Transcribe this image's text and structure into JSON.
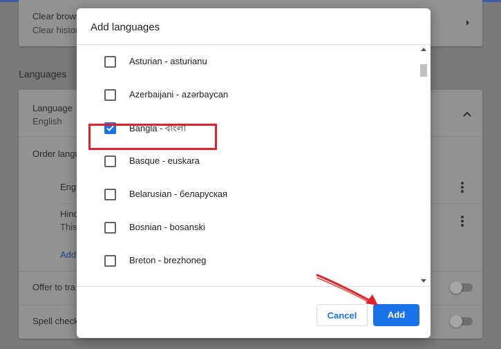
{
  "background": {
    "card1": {
      "title": "Clear brows",
      "subtitle": "Clear histor"
    },
    "section_title": "Languages",
    "language": {
      "label": "Language",
      "value": "English"
    },
    "order_label": "Order langu",
    "order_items": [
      {
        "label": "Engl",
        "sub": ""
      },
      {
        "label": "Hind",
        "sub": "This"
      }
    ],
    "add_link": "Add",
    "offer_translate": "Offer to tra",
    "spell_check": "Spell check"
  },
  "dialog": {
    "title": "Add languages",
    "languages": [
      {
        "label": "Asturian - asturianu",
        "checked": false
      },
      {
        "label": "Azerbaijani - azərbaycan",
        "checked": false
      },
      {
        "label": "Bangla - বাংলা",
        "checked": true
      },
      {
        "label": "Basque - euskara",
        "checked": false
      },
      {
        "label": "Belarusian - беларуская",
        "checked": false
      },
      {
        "label": "Bosnian - bosanski",
        "checked": false
      },
      {
        "label": "Breton - brezhoneg",
        "checked": false
      }
    ],
    "cancel_label": "Cancel",
    "add_label": "Add"
  },
  "colors": {
    "accent": "#1a73e8",
    "annotation": "#e3202b",
    "overlay_background": "#7a7a7a"
  },
  "icons": {
    "checkbox_checked": "check-icon",
    "expand": "chevron-up-icon",
    "navigate": "chevron-right-icon",
    "menu": "more-vert-icon",
    "annotation_arrow": "arrow-icon"
  }
}
